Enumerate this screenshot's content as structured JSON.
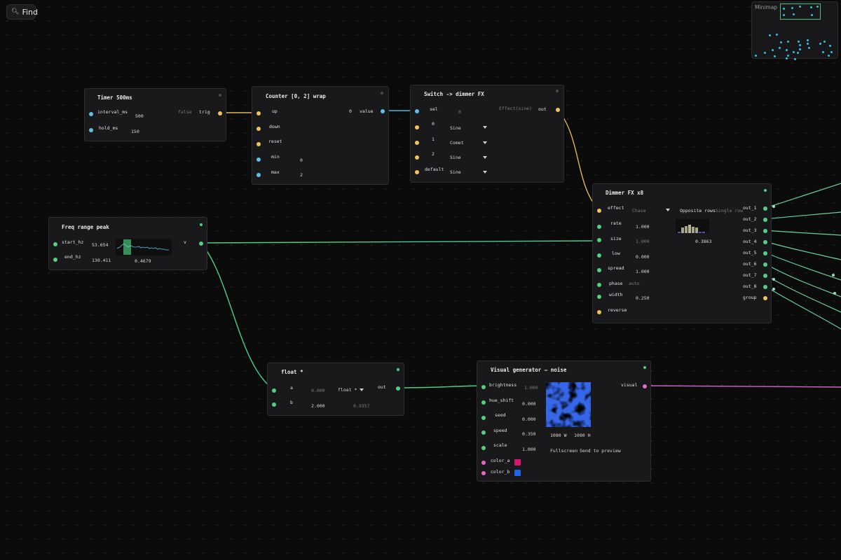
{
  "toolbar": {
    "find_label": "Find",
    "find_icon": "search-icon"
  },
  "minimap": {
    "title": "Minimap"
  },
  "colors": {
    "trigger": "#f2c35a",
    "number": "#5bc1e8",
    "float": "#52d185",
    "visual": "#e36ac2"
  },
  "timer": {
    "title": "Timer  500ms",
    "interval_label": "interval_ms",
    "interval_value": "500",
    "hold_label": "hold_ms",
    "hold_value": "150",
    "out_state": "false",
    "out_label": "trig"
  },
  "counter": {
    "title": "Counter  [0, 2] wrap",
    "up": "up",
    "down": "down",
    "reset": "reset",
    "min_label": "min",
    "min_value": "0",
    "max_label": "max",
    "max_value": "2",
    "value_num": "0",
    "value_label": "value"
  },
  "switch": {
    "title": "Switch -> dimmer FX",
    "sel_label": "sel",
    "sel_value": "0",
    "out_preview": "Effect(sine)",
    "out_label": "out",
    "rows": [
      {
        "label": "0",
        "value": "Sine"
      },
      {
        "label": "1",
        "value": "Comet"
      },
      {
        "label": "2",
        "value": "Sine"
      },
      {
        "label": "default",
        "value": "Sine"
      }
    ]
  },
  "freq": {
    "title": "Freq range peak",
    "start_label": "start_hz",
    "start_value": "53.654",
    "end_label": "end_hz",
    "end_value": "130.411",
    "peak_value": "0.4679",
    "out_label": "v"
  },
  "dimmer": {
    "title": "Dimmer FX  x8",
    "effect_label": "effect",
    "effect_value": "Chase",
    "mode_active": "Opposite rows",
    "mode_inactive": "Single row",
    "rate_label": "rate",
    "rate_value": "1.000",
    "size_label": "size",
    "size_value": "1.000",
    "low_label": "low",
    "low_value": "0.000",
    "spread_label": "spread",
    "spread_value": "1.000",
    "phase_label": "phase",
    "phase_value": "auto",
    "width_label": "width",
    "width_value": "0.250",
    "reverse_label": "reverse",
    "preview_value": "0.3863",
    "outputs": [
      "out_1",
      "out_2",
      "out_3",
      "out_4",
      "out_5",
      "out_6",
      "out_7",
      "out_8",
      "group"
    ]
  },
  "float_node": {
    "title": "float  *",
    "a_label": "a",
    "a_value": "0.000",
    "op_value": "float *",
    "b_label": "b",
    "b_value": "2.000",
    "result": "0.9357",
    "out_label": "out"
  },
  "visual": {
    "title": "Visual generator — noise",
    "brightness_label": "brightness",
    "brightness_value": "1.000",
    "hue_label": "hue_shift",
    "hue_value": "0.000",
    "seed_label": "seed",
    "seed_value": "0.000",
    "speed_label": "speed",
    "speed_value": "0.350",
    "scale_label": "scale",
    "scale_value": "1.000",
    "color_a_label": "color_a",
    "color_a": "#d6156f",
    "color_b_label": "color_b",
    "color_b": "#1f63e6",
    "width_text": "1080 W",
    "height_text": "1080 H",
    "fullscreen_label": "Fullscreen",
    "send_label": "Send to preview",
    "out_label": "visual"
  }
}
